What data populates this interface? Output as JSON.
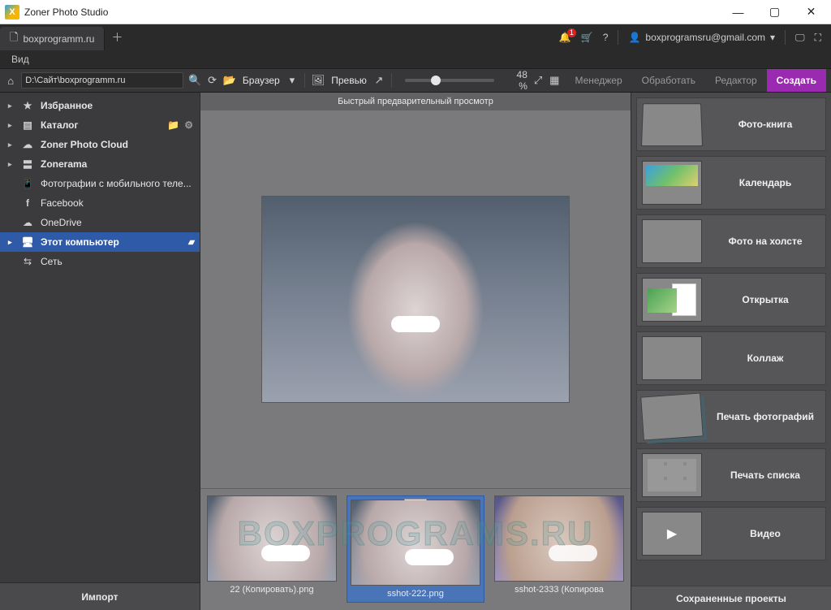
{
  "window": {
    "title": "Zoner Photo Studio"
  },
  "appbar": {
    "tab_label": "boxprogramm.ru",
    "notif_badge": "1",
    "user_email": "boxprogramsru@gmail.com"
  },
  "menubar": {
    "view": "Вид"
  },
  "toolbar": {
    "path": "D:\\Сайт\\boxprogramm.ru",
    "browser_label": "Браузер",
    "preview_label": "Превью",
    "zoom_pct": "48 %"
  },
  "modes": {
    "manager": "Менеджер",
    "process": "Обработать",
    "editor": "Редактор",
    "create": "Создать"
  },
  "sidebar": {
    "items": [
      {
        "label": "Избранное"
      },
      {
        "label": "Каталог"
      },
      {
        "label": "Zoner Photo Cloud"
      },
      {
        "label": "Zonerama"
      },
      {
        "label": "Фотографии с мобильного теле..."
      },
      {
        "label": "Facebook"
      },
      {
        "label": "OneDrive"
      },
      {
        "label": "Этот компьютер"
      },
      {
        "label": "Сеть"
      }
    ],
    "import": "Импорт"
  },
  "preview": {
    "header": "Быстрый предварительный просмотр"
  },
  "strip": {
    "items": [
      {
        "caption": "22 (Копировать).png"
      },
      {
        "caption": "sshot-222.png"
      },
      {
        "caption": "sshot-2333 (Копирова"
      }
    ]
  },
  "rpanel": {
    "items": [
      {
        "label": "Фото-книга"
      },
      {
        "label": "Календарь"
      },
      {
        "label": "Фото на холсте"
      },
      {
        "label": "Открытка"
      },
      {
        "label": "Коллаж"
      },
      {
        "label": "Печать фотографий"
      },
      {
        "label": "Печать списка"
      },
      {
        "label": "Видео"
      }
    ],
    "saved": "Сохраненные проекты"
  },
  "watermark": "BOXPROGRAMS.RU"
}
